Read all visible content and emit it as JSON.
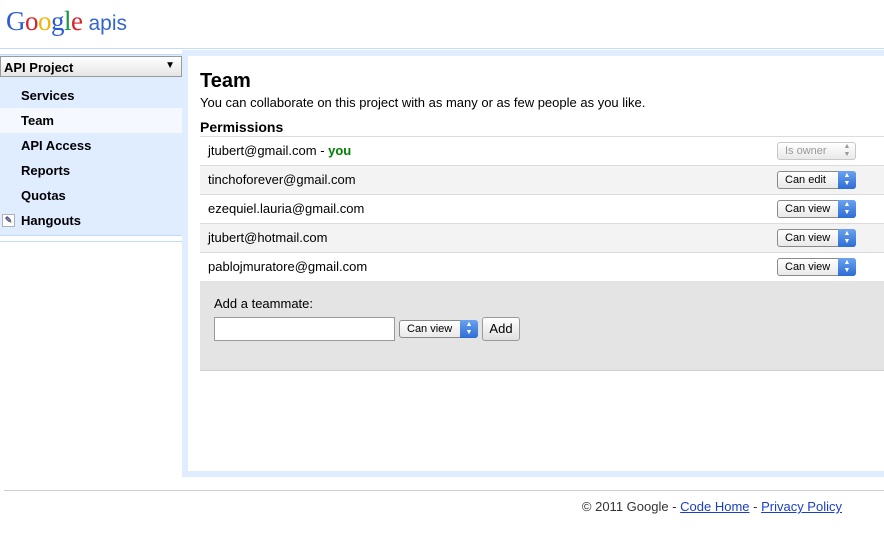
{
  "logo": {
    "letters": [
      "G",
      "o",
      "o",
      "g",
      "l",
      "e"
    ],
    "colors": [
      "#2a5bd7",
      "#d6242b",
      "#f2b705",
      "#2a5bd7",
      "#1a9a3a",
      "#d6242b"
    ],
    "suffix": "apis"
  },
  "sidebar": {
    "project_select": "API Project",
    "dropdown_arrow": "▼",
    "items": [
      {
        "label": "Services"
      },
      {
        "label": "Team",
        "selected": true
      },
      {
        "label": "API Access"
      },
      {
        "label": "Reports"
      },
      {
        "label": "Quotas"
      },
      {
        "label": "Hangouts",
        "icon": "hangouts-icon"
      }
    ]
  },
  "main": {
    "title": "Team",
    "subtitle": "You can collaborate on this project with as many or as few people as you like.",
    "permissions_heading": "Permissions",
    "rows": [
      {
        "email": "jtubert@gmail.com",
        "separator": " - ",
        "you_label": "you",
        "permission": "Is owner",
        "disabled": true
      },
      {
        "email": "tinchoforever@gmail.com",
        "permission": "Can edit"
      },
      {
        "email": "ezequiel.lauria@gmail.com",
        "permission": "Can view"
      },
      {
        "email": "jtubert@hotmail.com",
        "permission": "Can view"
      },
      {
        "email": "pablojmuratore@gmail.com",
        "permission": "Can view"
      }
    ],
    "add_teammate": {
      "label": "Add a teammate:",
      "input_value": "",
      "permission": "Can view",
      "button": "Add"
    }
  },
  "footer": {
    "copyright": "© 2011 Google - ",
    "link1": "Code Home",
    "separator": " - ",
    "link2": "Privacy Policy"
  }
}
